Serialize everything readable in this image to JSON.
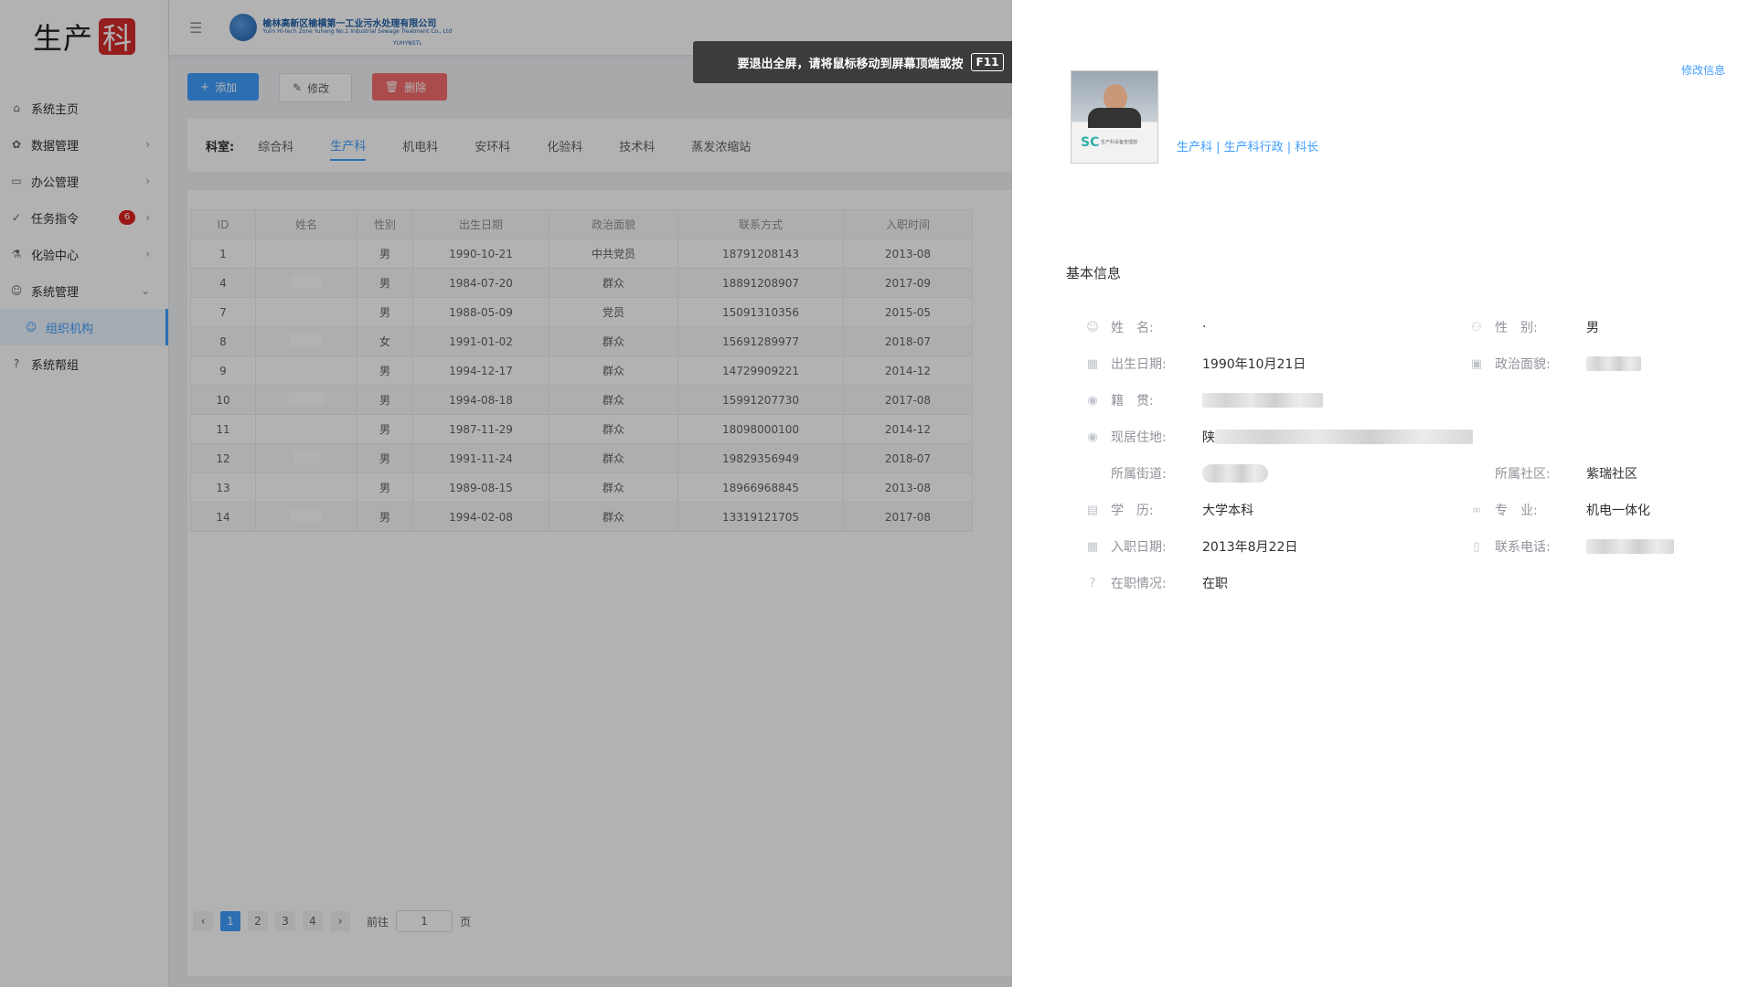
{
  "sidebar": {
    "brand_text": "生产",
    "brand_badge": "科",
    "items": [
      {
        "icon": "home-icon",
        "glyph": "⌂",
        "label": "系统主页"
      },
      {
        "icon": "gear-icon",
        "glyph": "✿",
        "label": "数据管理"
      },
      {
        "icon": "folder-icon",
        "glyph": "▭",
        "label": "办公管理"
      },
      {
        "icon": "check-icon",
        "glyph": "✓",
        "label": "任务指令",
        "badge": "6"
      },
      {
        "icon": "flask-icon",
        "glyph": "⚗",
        "label": "化验中心"
      },
      {
        "icon": "users-icon",
        "glyph": "☺",
        "label": "系统管理"
      },
      {
        "icon": "org-icon",
        "glyph": "☺",
        "label": "组织机构"
      },
      {
        "icon": "help-icon",
        "glyph": "?",
        "label": "系统帮组"
      }
    ]
  },
  "header": {
    "logo_cn": "榆林高新区榆横第一工业污水处理有限公司",
    "logo_en": "Yulin Hi-tech Zone Yuheng No.1 Industrial Sewage Treatment Co., Ltd",
    "logo_sub": "YUHYNSTL"
  },
  "toolbar": {
    "add": "添加",
    "edit": "修改",
    "delete": "删除"
  },
  "dept_tabs": {
    "label": "科室:",
    "items": [
      "综合科",
      "生产科",
      "机电科",
      "安环科",
      "化验科",
      "技术科",
      "蒸发浓缩站"
    ],
    "active": "生产科"
  },
  "table": {
    "columns": [
      "ID",
      "姓名",
      "性别",
      "出生日期",
      "政治面貌",
      "联系方式",
      "入职时间"
    ],
    "rows": [
      [
        "1",
        "",
        "男",
        "1990-10-21",
        "中共党员",
        "18791208143",
        "2013-08"
      ],
      [
        "4",
        "",
        "男",
        "1984-07-20",
        "群众",
        "18891208907",
        "2017-09"
      ],
      [
        "7",
        "",
        "男",
        "1988-05-09",
        "党员",
        "15091310356",
        "2015-05"
      ],
      [
        "8",
        "",
        "女",
        "1991-01-02",
        "群众",
        "15691289977",
        "2018-07"
      ],
      [
        "9",
        "",
        "男",
        "1994-12-17",
        "群众",
        "14729909221",
        "2014-12"
      ],
      [
        "10",
        "",
        "男",
        "1994-08-18",
        "群众",
        "15991207730",
        "2017-08"
      ],
      [
        "11",
        "",
        "男",
        "1987-11-29",
        "群众",
        "18098000100",
        "2014-12"
      ],
      [
        "12",
        "",
        "男",
        "1991-11-24",
        "群众",
        "19829356949",
        "2018-07"
      ],
      [
        "13",
        "",
        "男",
        "1989-08-15",
        "群众",
        "18966968845",
        "2013-08"
      ],
      [
        "14",
        "",
        "男",
        "1994-02-08",
        "群众",
        "13319121705",
        "2017-08"
      ]
    ]
  },
  "pagination": {
    "pages": [
      "1",
      "2",
      "3",
      "4"
    ],
    "current": "1",
    "goto_label": "前往",
    "goto_value": "1",
    "page_unit": "页",
    "prev": "‹",
    "next": "›"
  },
  "toast": {
    "text": "要退出全屏，请将鼠标移动到屏幕顶端或按",
    "key": "F11"
  },
  "drawer": {
    "edit_link": "修改信息",
    "dept_line": "生产科 | 生产科行政 | 科长",
    "avatar_logo": "SC",
    "avatar_caption": "生产科设备管理部",
    "section_title": "基本信息",
    "fields": {
      "name": {
        "label": "姓　名:",
        "value": "·"
      },
      "gender": {
        "label": "性　别:",
        "value": "男"
      },
      "birth": {
        "label": "出生日期:",
        "value": "1990年10月21日"
      },
      "politics": {
        "label": "政治面貌:",
        "value": ""
      },
      "native": {
        "label": "籍　贯:",
        "value": ""
      },
      "address": {
        "label": "现居住地:",
        "value": "陕"
      },
      "street": {
        "label": "所属街道:",
        "value": ""
      },
      "community": {
        "label": "所属社区:",
        "value": "紫瑞社区"
      },
      "education": {
        "label": "学　历:",
        "value": "大学本科"
      },
      "major": {
        "label": "专　业:",
        "value": "机电一体化"
      },
      "hire_date": {
        "label": "入职日期:",
        "value": "2013年8月22日"
      },
      "phone": {
        "label": "联系电话:",
        "value": ""
      },
      "status": {
        "label": "在职情况:",
        "value": "在职"
      }
    }
  }
}
